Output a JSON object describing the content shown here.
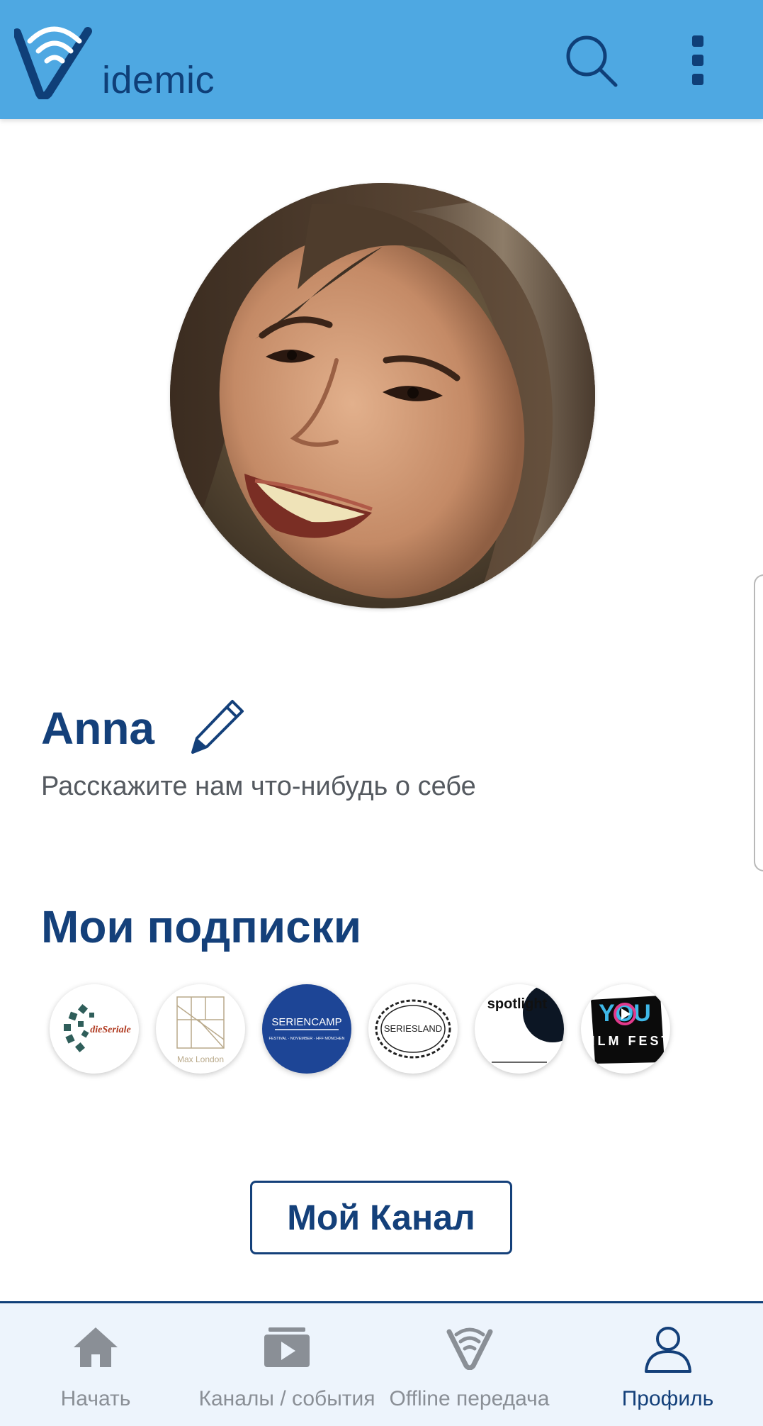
{
  "app": {
    "logo_text": "idemic"
  },
  "header": {
    "search_icon": "search-icon",
    "menu_icon": "more-vertical-icon"
  },
  "profile": {
    "name": "Anna",
    "bio_placeholder": "Расскажите нам что-нибудь о себе",
    "edit_icon": "pencil-icon"
  },
  "subscriptions": {
    "title": "Мои подписки",
    "items": [
      {
        "name": "dieSeriale",
        "logo_text": "dieSeriale"
      },
      {
        "name": "Max London",
        "logo_text": "Max London"
      },
      {
        "name": "Seriencamp",
        "logo_text": "SERIENCAMP",
        "logo_subtext": "FESTIVAL · NOVEMBER · HFF MÜNCHEN"
      },
      {
        "name": "Seriesland",
        "logo_text": "SERIESLAND"
      },
      {
        "name": "spotlight",
        "logo_text": "spotlight"
      },
      {
        "name": "YOU Film Fest",
        "logo_text": "YOU",
        "logo_subtext": "FILM FEST"
      }
    ]
  },
  "channel_button": {
    "label": "Мой Канал"
  },
  "bottom_nav": {
    "items": [
      {
        "label": "Начать",
        "icon": "home-icon",
        "active": false
      },
      {
        "label": "Каналы / события",
        "icon": "channels-play-icon",
        "active": false
      },
      {
        "label": "Offline передача",
        "icon": "offline-wifi-icon",
        "active": false
      },
      {
        "label": "Профиль",
        "icon": "user-icon",
        "active": true
      }
    ]
  },
  "colors": {
    "header_bg": "#4ea8e2",
    "brand_dark": "#14407a",
    "nav_bg": "#edf4fc",
    "nav_inactive": "#8a8f96"
  }
}
